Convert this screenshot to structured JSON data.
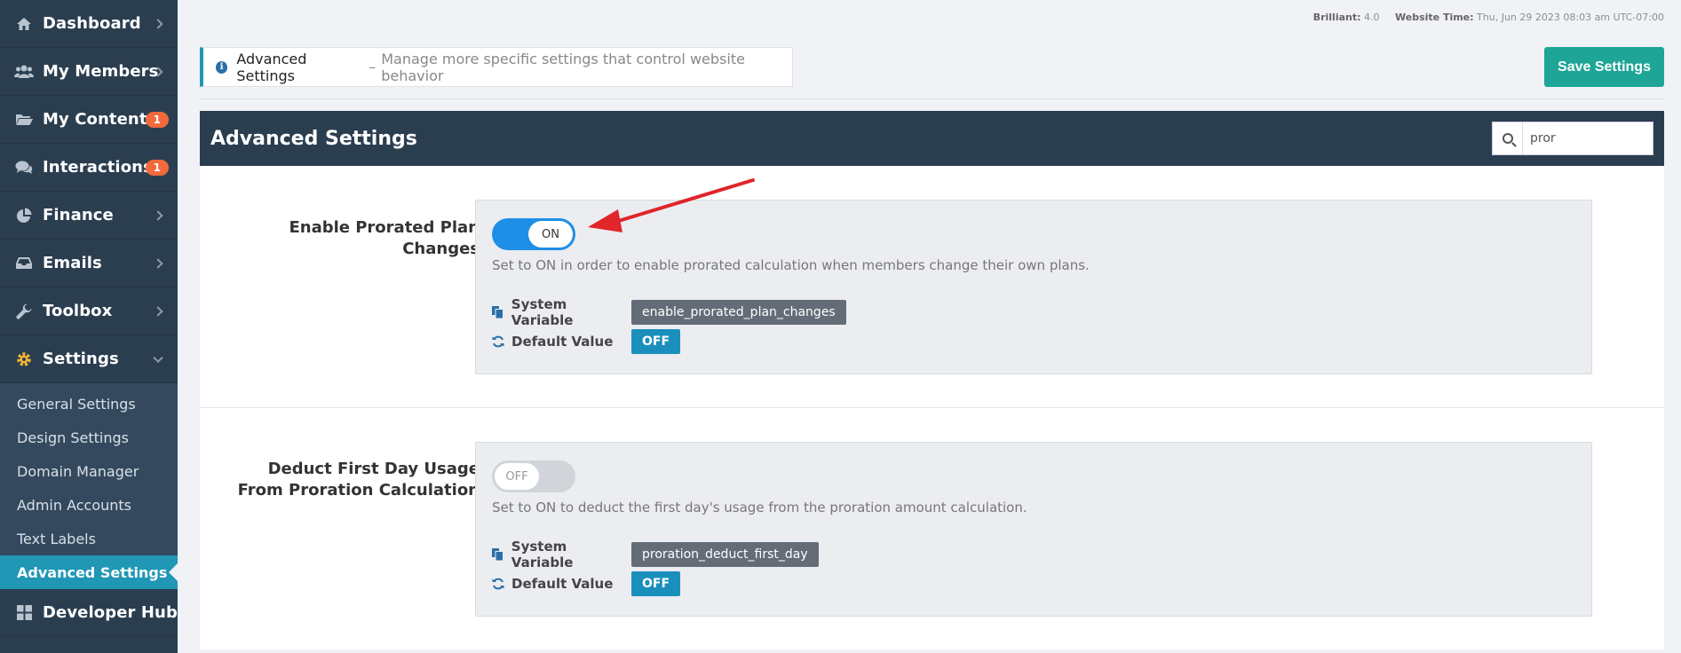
{
  "sidebar": {
    "items": [
      {
        "label": "Dashboard",
        "icon": "home-icon",
        "badge": ""
      },
      {
        "label": "My Members",
        "icon": "users-icon",
        "badge": ""
      },
      {
        "label": "My Content",
        "icon": "folder-icon",
        "badge": "1"
      },
      {
        "label": "Interactions",
        "icon": "comments-icon",
        "badge": "1"
      },
      {
        "label": "Finance",
        "icon": "pie-chart-icon",
        "badge": ""
      },
      {
        "label": "Emails",
        "icon": "inbox-icon",
        "badge": ""
      },
      {
        "label": "Toolbox",
        "icon": "wrench-icon",
        "badge": ""
      },
      {
        "label": "Settings",
        "icon": "gear-icon",
        "badge": ""
      }
    ],
    "subitems": [
      {
        "label": "General Settings"
      },
      {
        "label": "Design Settings"
      },
      {
        "label": "Domain Manager"
      },
      {
        "label": "Admin Accounts"
      },
      {
        "label": "Text Labels"
      },
      {
        "label": "Advanced Settings"
      }
    ],
    "bottom_item": {
      "label": "Developer Hub",
      "icon": "grid-icon"
    }
  },
  "topinfo": {
    "version_label": "Brilliant:",
    "version_value": "4.0",
    "time_label": "Website Time:",
    "time_value": "Thu, Jun 29 2023 08:03 am UTC-07:00"
  },
  "banner": {
    "title": "Advanced Settings",
    "separator": "–",
    "description": "Manage more specific settings that control website behavior"
  },
  "save_label": "Save Settings",
  "panel": {
    "title": "Advanced Settings",
    "search_value": "pror"
  },
  "settings": [
    {
      "label": "Enable Prorated Plan Changes",
      "state": "ON",
      "description": "Set to ON in order to enable prorated calculation when members change their own plans.",
      "system_variable_label": "System Variable",
      "system_variable": "enable_prorated_plan_changes",
      "default_value_label": "Default Value",
      "default_value": "OFF"
    },
    {
      "label": "Deduct First Day Usage From Proration Calculation",
      "state": "OFF",
      "description": "Set to ON to deduct the first day's usage from the proration amount calculation.",
      "system_variable_label": "System Variable",
      "system_variable": "proration_deduct_first_day",
      "default_value_label": "Default Value",
      "default_value": "OFF"
    }
  ],
  "colors": {
    "sidebar": "#2b3e50",
    "accent": "#1f97b5",
    "save": "#1ea597",
    "toggle_on": "#1e8ee6",
    "badge": "#f26a3b",
    "annotation_arrow": "#e0252b"
  }
}
